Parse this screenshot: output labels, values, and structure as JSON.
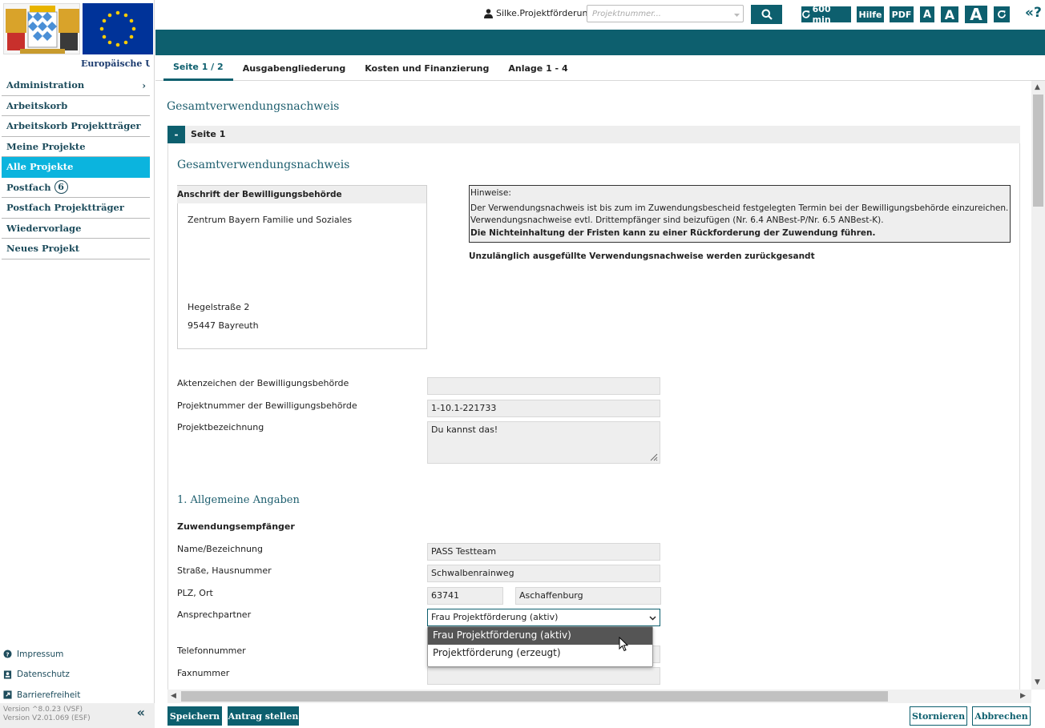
{
  "sidebar": {
    "eu_caption": "Europäische Union",
    "nav": [
      {
        "label": "Administration",
        "has_submenu": true
      },
      {
        "label": "Arbeitskorb"
      },
      {
        "label": "Arbeitskorb Projektträger"
      },
      {
        "label": "Meine Projekte"
      },
      {
        "label": "Alle Projekte",
        "active": true
      },
      {
        "label": "Postfach",
        "badge": "6"
      },
      {
        "label": "Postfach Projektträger"
      },
      {
        "label": "Wiedervorlage"
      },
      {
        "label": "Neues Projekt"
      }
    ],
    "footer": [
      {
        "label": "Impressum",
        "icon": "question-circle-icon"
      },
      {
        "label": "Datenschutz",
        "icon": "id-card-icon"
      },
      {
        "label": "Barrierefreiheit",
        "icon": "external-link-icon"
      }
    ],
    "version_1": "Version ^8.0.23 (VSF)",
    "version_2": "Version V2.01.069 (ESF)"
  },
  "topbar": {
    "user": "Silke.Projektförderung",
    "search_placeholder": "Projektnummer...",
    "session": "600 min",
    "help": "Hilfe",
    "pdf": "PDF",
    "font_small": "A",
    "font_medium": "A",
    "font_large": "A",
    "help_icon": "«?"
  },
  "tabs": [
    {
      "label": "Seite 1 / 2",
      "active": true
    },
    {
      "label": "Ausgabengliederung"
    },
    {
      "label": "Kosten und Finanzierung"
    },
    {
      "label": "Anlage 1 - 4"
    }
  ],
  "content": {
    "page_heading": "Gesamtverwendungsnachweis",
    "section_toggle": "-",
    "section_title": "Seite 1",
    "form_heading": "Gesamtverwendungsnachweis",
    "address": {
      "header": "Anschrift der Bewilligungsbehörde",
      "name": "Zentrum Bayern Familie und Soziales",
      "street": "Hegelstraße 2",
      "city": "95447  Bayreuth"
    },
    "hint": {
      "title": "Hinweise:",
      "line1": "Der Verwendungsnachweis ist bis zum im Zuwendungsbescheid festgelegten Termin bei der Bewilligungsbehörde einzureichen.",
      "line2": "Verwendungsnachweise evtl. Drittempfänger sind beizufügen (Nr. 6.4 ANBest-P/Nr. 6.5 ANBest-K).",
      "line3": "Die Nichteinhaltung der Fristen kann zu einer Rückforderung der Zuwendung führen.",
      "warning": "Unzulänglich ausgefüllte Verwendungsnachweise werden zurückgesandt"
    },
    "fields": {
      "aktenzeichen_label": "Aktenzeichen der Bewilligungsbehörde",
      "aktenzeichen_value": "",
      "projektnummer_label": "Projektnummer der Bewilligungsbehörde",
      "projektnummer_value": "1-10.1-221733",
      "projektbez_label": "Projektbezeichnung",
      "projektbez_value": "Du kannst das!"
    },
    "section1_heading": "1. Allgemeine Angaben",
    "recipient_heading": "Zuwendungsempfänger",
    "recipient": {
      "name_label": "Name/Bezeichnung",
      "name_value": "PASS Testteam",
      "street_label": "Straße, Hausnummer",
      "street_value": "Schwalbenrainweg",
      "plz_label": "PLZ, Ort",
      "plz_value": "63741",
      "ort_value": "Aschaffenburg",
      "contact_label": "Ansprechpartner",
      "contact_value": "Frau Projektförderung (aktiv)",
      "contact_options": [
        "Frau Projektförderung (aktiv)",
        "Projektförderung (erzeugt)"
      ],
      "phone_label": "Telefonnummer",
      "fax_label": "Faxnummer"
    }
  },
  "bottom": {
    "save": "Speichern",
    "submit": "Antrag stellen",
    "cancel_storno": "Stornieren",
    "abort": "Abbrechen"
  },
  "colors": {
    "primary": "#0d5f6e",
    "active_nav": "#0bb4de",
    "heading": "#1d5e6e"
  }
}
